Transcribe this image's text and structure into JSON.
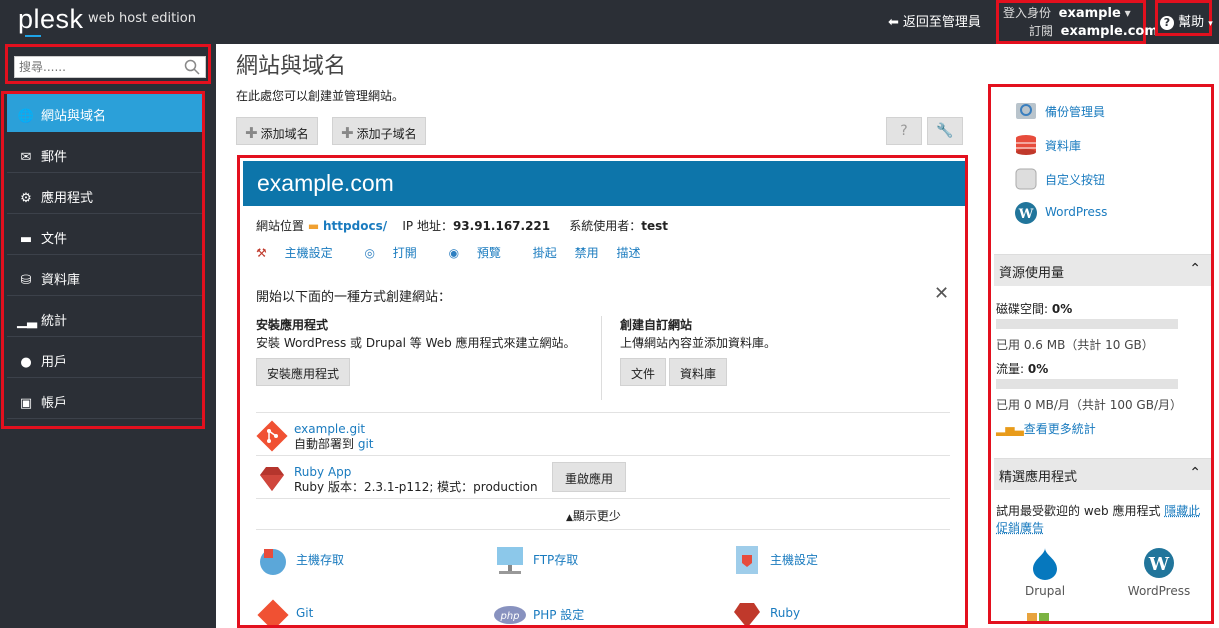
{
  "header": {
    "logo": "plesk",
    "edition": "web host edition",
    "back_label": "返回至管理員",
    "logged_in_label": "登入身份",
    "logged_in_user": "example",
    "subscription_label": "訂閱",
    "subscription_value": "example.com",
    "help_label": "幫助"
  },
  "search": {
    "placeholder": "搜尋......"
  },
  "nav": [
    {
      "label": "網站與域名",
      "icon": "globe-icon",
      "active": true
    },
    {
      "label": "郵件",
      "icon": "mail-icon"
    },
    {
      "label": "應用程式",
      "icon": "gear-icon"
    },
    {
      "label": "文件",
      "icon": "folder-icon"
    },
    {
      "label": "資料庫",
      "icon": "database-icon"
    },
    {
      "label": "統計",
      "icon": "bar-chart-icon"
    },
    {
      "label": "用戶",
      "icon": "user-icon"
    },
    {
      "label": "帳戶",
      "icon": "account-icon"
    }
  ],
  "main": {
    "title": "網站與域名",
    "description": "在此處您可以創建並管理網站。",
    "add_domain": "添加域名",
    "add_subdomain": "添加子域名"
  },
  "domain": {
    "name": "example.com",
    "location_label": "網站位置",
    "location_value": "httpdocs/",
    "ip_label": "IP 地址：",
    "ip_value": "93.91.167.221",
    "sysuser_label": "系統使用者：",
    "sysuser_value": "test",
    "links": [
      "主機設定",
      "打開",
      "預覽",
      "掛起",
      "禁用",
      "描述"
    ],
    "start_title": "開始以下面的一種方式創建網站：",
    "apps_title": "安裝應用程式",
    "apps_desc": "安裝 WordPress 或 Drupal 等 Web 應用程式來建立網站。",
    "apps_button": "安裝應用程式",
    "custom_title": "創建自訂網站",
    "custom_desc": "上傳網站內容並添加資料庫。",
    "files_button": "文件",
    "db_button": "資料庫",
    "git_name": "example.git",
    "git_desc_prefix": "自動部署到",
    "git_desc_link": "git",
    "ruby_name": "Ruby App",
    "ruby_desc": "Ruby 版本：2.3.1-p112; 模式：production",
    "restart_button": "重啟應用",
    "show_less": "顯示更少",
    "tools": [
      "主機存取",
      "FTP存取",
      "主機設定",
      "Git",
      "PHP 設定",
      "Ruby"
    ]
  },
  "right": {
    "links": [
      "備份管理員",
      "資料庫",
      "自定义按钮",
      "WordPress"
    ],
    "resources_title": "資源使用量",
    "disk_label": "磁碟空間:",
    "disk_value": "0%",
    "disk_used": "已用 0.6 MB（共計 10 GB）",
    "disk_fraction": 0,
    "traffic_label": "流量:",
    "traffic_value": "0%",
    "traffic_used": "已用 0 MB/月（共計 100 GB/月）",
    "traffic_fraction": 0,
    "more_stats": "查看更多統計",
    "featured_title": "精選應用程式",
    "featured_desc": "試用最受歡迎的 web 應用程式",
    "hide_ad": "隱藏此",
    "hide_ad_2": "促銷廣告",
    "featured_apps": [
      "Drupal",
      "WordPress"
    ]
  }
}
